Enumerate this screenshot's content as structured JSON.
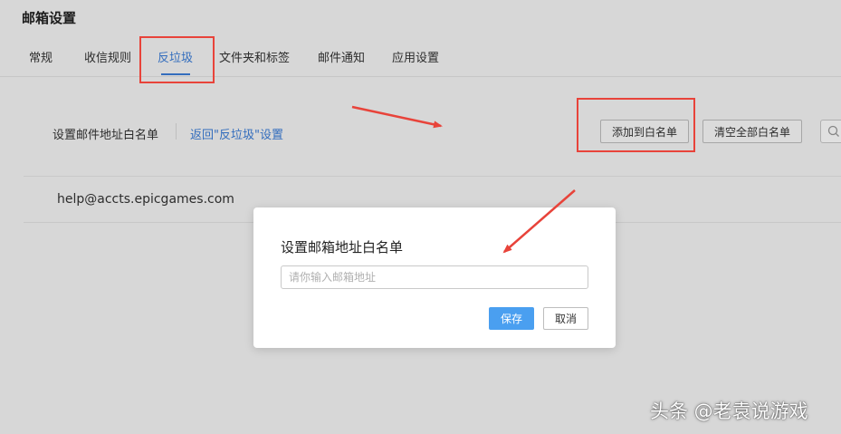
{
  "page": {
    "title": "邮箱设置"
  },
  "tabs": [
    {
      "label": "常规"
    },
    {
      "label": "收信规则"
    },
    {
      "label": "反垃圾"
    },
    {
      "label": "文件夹和标签"
    },
    {
      "label": "邮件通知"
    },
    {
      "label": "应用设置"
    }
  ],
  "toolbar": {
    "label": "设置邮件地址白名单",
    "back_link": "返回\"反垃圾\"设置",
    "add_button": "添加到白名单",
    "clear_button": "清空全部白名单"
  },
  "whitelist": {
    "items": [
      "help@accts.epicgames.com"
    ]
  },
  "modal": {
    "title": "设置邮箱地址白名单",
    "input_placeholder": "请你输入邮箱地址",
    "input_value": "",
    "save_label": "保存",
    "cancel_label": "取消"
  },
  "colors": {
    "accent": "#3b7dd8",
    "primary_button": "#4a9ff0",
    "annotation": "#e8433a"
  },
  "watermark": {
    "text": "头条 @老袁说游戏"
  }
}
